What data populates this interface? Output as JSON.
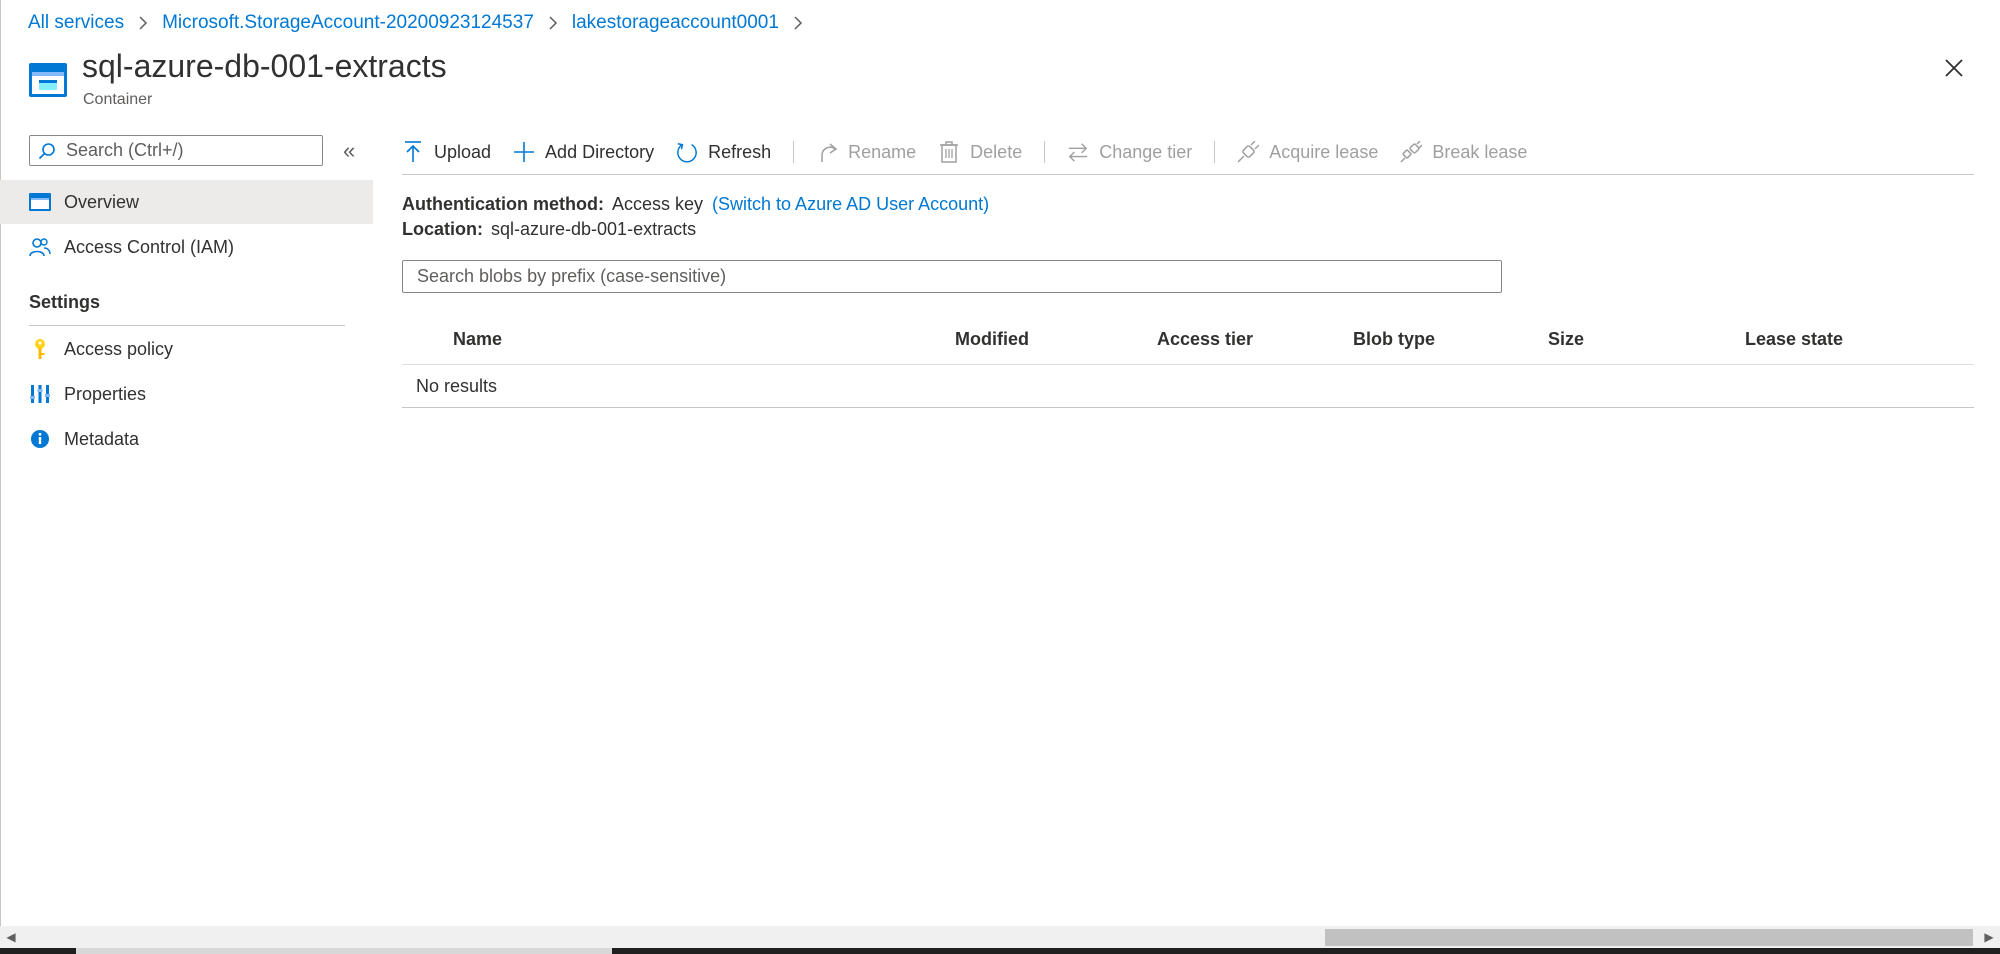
{
  "breadcrumb": {
    "items": [
      "All services",
      "Microsoft.StorageAccount-20200923124537",
      "lakestorageaccount0001"
    ]
  },
  "header": {
    "title": "sql-azure-db-001-extracts",
    "subtitle": "Container"
  },
  "sidebar": {
    "search_placeholder": "Search (Ctrl+/)",
    "items": [
      {
        "label": "Overview",
        "icon": "overview-icon"
      },
      {
        "label": "Access Control (IAM)",
        "icon": "people-icon"
      }
    ],
    "settings_header": "Settings",
    "settings_items": [
      {
        "label": "Access policy",
        "icon": "key-icon"
      },
      {
        "label": "Properties",
        "icon": "properties-icon"
      },
      {
        "label": "Metadata",
        "icon": "info-icon"
      }
    ]
  },
  "toolbar": {
    "upload": "Upload",
    "add_directory": "Add Directory",
    "refresh": "Refresh",
    "rename": "Rename",
    "delete": "Delete",
    "change_tier": "Change tier",
    "acquire_lease": "Acquire lease",
    "break_lease": "Break lease"
  },
  "info": {
    "auth_label": "Authentication method:",
    "auth_value": "Access key",
    "auth_link": "(Switch to Azure AD User Account)",
    "location_label": "Location:",
    "location_value": "sql-azure-db-001-extracts"
  },
  "blob_search": {
    "placeholder": "Search blobs by prefix (case-sensitive)"
  },
  "table": {
    "columns": [
      "Name",
      "Modified",
      "Access tier",
      "Blob type",
      "Size",
      "Lease state"
    ],
    "empty_message": "No results"
  },
  "colors": {
    "accent": "#0078d4",
    "selected_bg": "#edebe9",
    "disabled_text": "#a19f9d"
  }
}
